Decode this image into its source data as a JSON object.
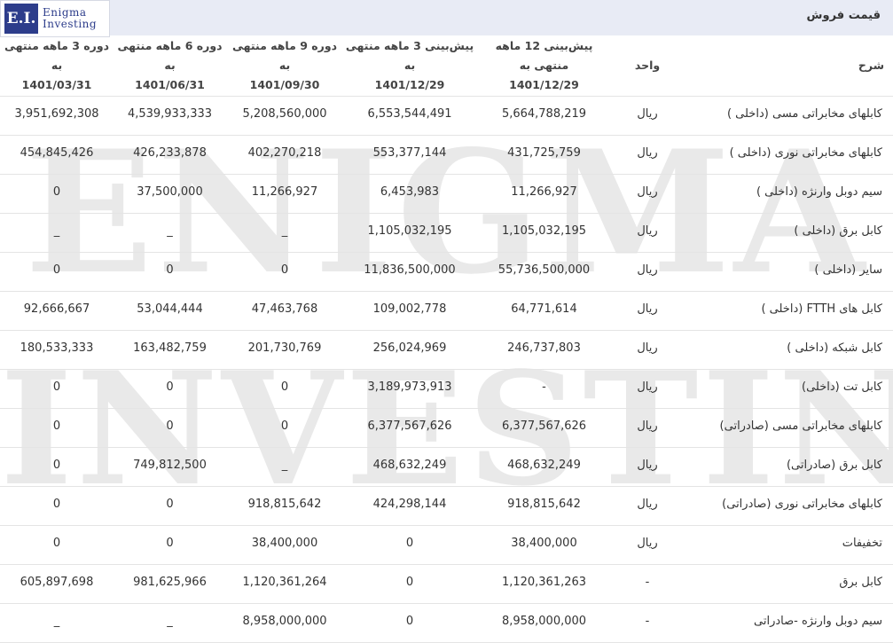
{
  "logo": {
    "initials": "E.I.",
    "line1": "Enigma",
    "line2": "Investing"
  },
  "watermark": {
    "line1": "ENIGMA",
    "line2": "INVESTING"
  },
  "section_title": "قیمت فروش",
  "headers": {
    "period_3m": [
      "دوره 3 ماهه منتهی به",
      "1401/03/31"
    ],
    "period_6m": [
      "دوره 6 ماهه منتهی به",
      "1401/06/31"
    ],
    "period_9m": [
      "دوره 9 ماهه منتهی به",
      "1401/09/30"
    ],
    "forecast_3m": [
      "پیش‌بینی 3 ماهه منتهی به",
      "1401/12/29"
    ],
    "forecast_12m": [
      "پیش‌بینی 12 ماهه منتهی به",
      "1401/12/29"
    ],
    "unit": "واحد",
    "description": "شرح"
  },
  "rows": [
    {
      "desc": "کابلهای مخابراتی مسی (داخلی )",
      "unit": "ریال",
      "f12": "5,664,788,219",
      "f3": "6,553,544,491",
      "p9": "5,208,560,000",
      "p6": "4,539,933,333",
      "p3": "3,951,692,308"
    },
    {
      "desc": "کابلهای مخابراتی نوری (داخلی )",
      "unit": "ریال",
      "f12": "431,725,759",
      "f3": "553,377,144",
      "p9": "402,270,218",
      "p6": "426,233,878",
      "p3": "454,845,426"
    },
    {
      "desc": "سیم دوبل وارنژه (داخلی )",
      "unit": "ریال",
      "f12": "11,266,927",
      "f3": "6,453,983",
      "p9": "11,266,927",
      "p6": "37,500,000",
      "p3": "0"
    },
    {
      "desc": "کابل برق (داخلی )",
      "unit": "ریال",
      "f12": "1,105,032,195",
      "f3": "1,105,032,195",
      "p9": "_",
      "p6": "_",
      "p3": "_"
    },
    {
      "desc": "سایر (داخلی )",
      "unit": "ریال",
      "f12": "55,736,500,000",
      "f3": "11,836,500,000",
      "p9": "0",
      "p6": "0",
      "p3": "0"
    },
    {
      "desc": "کابل های FTTH (داخلی )",
      "unit": "ریال",
      "f12": "64,771,614",
      "f3": "109,002,778",
      "p9": "47,463,768",
      "p6": "53,044,444",
      "p3": "92,666,667"
    },
    {
      "desc": "کابل شبکه (داخلی )",
      "unit": "ریال",
      "f12": "246,737,803",
      "f3": "256,024,969",
      "p9": "201,730,769",
      "p6": "163,482,759",
      "p3": "180,533,333"
    },
    {
      "desc": "کابل تت (داخلی)",
      "unit": "ریال",
      "f12": "-",
      "f3": "3,189,973,913",
      "p9": "0",
      "p6": "0",
      "p3": "0"
    },
    {
      "desc": "کابلهای مخابراتی مسی (صادراتی)",
      "unit": "ریال",
      "f12": "6,377,567,626",
      "f3": "6,377,567,626",
      "p9": "0",
      "p6": "0",
      "p3": "0"
    },
    {
      "desc": "کابل برق (صادراتی)",
      "unit": "ریال",
      "f12": "468,632,249",
      "f3": "468,632,249",
      "p9": "_",
      "p6": "749,812,500",
      "p3": "0"
    },
    {
      "desc": "کابلهای مخابراتی نوری (صادراتی)",
      "unit": "ریال",
      "f12": "918,815,642",
      "f3": "424,298,144",
      "p9": "918,815,642",
      "p6": "0",
      "p3": "0"
    },
    {
      "desc": "تخفیفات",
      "unit": "ریال",
      "f12": "38,400,000",
      "f3": "0",
      "p9": "38,400,000",
      "p6": "0",
      "p3": "0"
    },
    {
      "desc": "کابل برق",
      "unit": "-",
      "f12": "1,120,361,263",
      "f3": "0",
      "p9": "1,120,361,264",
      "p6": "981,625,966",
      "p3": "605,897,698"
    },
    {
      "desc": "سیم دوبل وارنژه -صادراتی",
      "unit": "-",
      "f12": "8,958,000,000",
      "f3": "0",
      "p9": "8,958,000,000",
      "p6": "_",
      "p3": "_"
    }
  ]
}
